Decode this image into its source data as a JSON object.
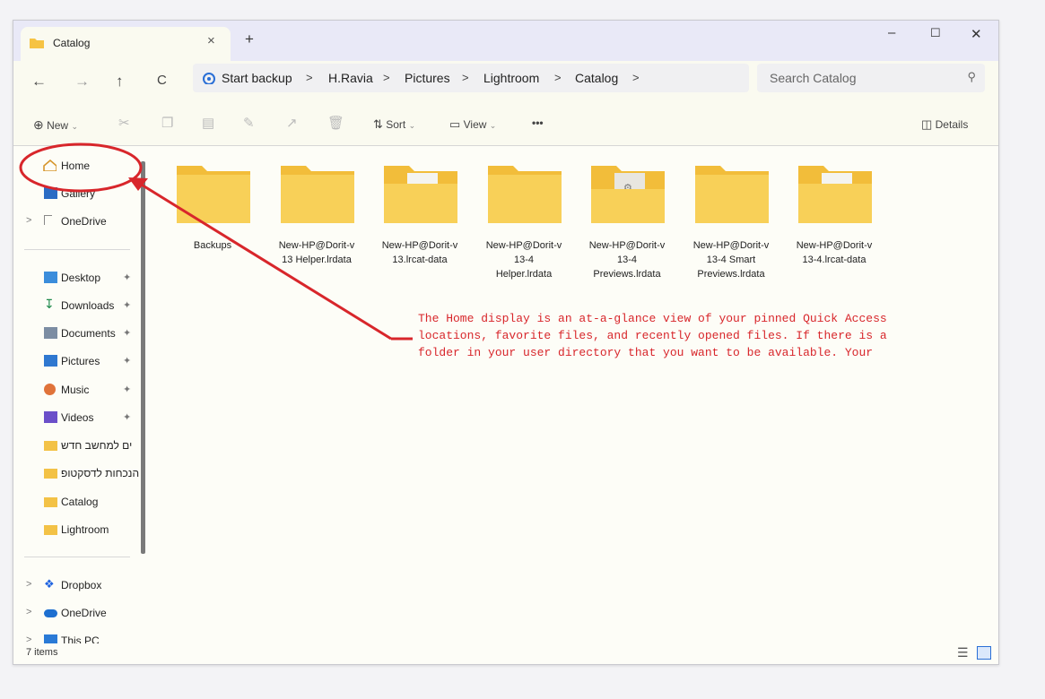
{
  "window": {
    "tab_title": "Catalog",
    "tab_close": "×",
    "new_tab": "+",
    "minimize": "–",
    "maximize": "☐",
    "close": "✕"
  },
  "nav": {
    "back": "←",
    "forward": "→",
    "up": "↑",
    "refresh": "C"
  },
  "breadcrumb": {
    "start": "Start backup",
    "parts": [
      "H.Ravia",
      "Pictures",
      "Lightroom",
      "Catalog"
    ],
    "sep": ">"
  },
  "search": {
    "placeholder": "Search Catalog",
    "icon": "search-icon"
  },
  "toolbar": {
    "new_label": "New",
    "sort_label": "Sort",
    "view_label": "View",
    "more_label": "•••",
    "details_label": "Details"
  },
  "sidebar": {
    "items": [
      {
        "label": "Home",
        "icon": "home-icon"
      },
      {
        "label": "Gallery",
        "icon": "gallery-icon"
      },
      {
        "label": "OneDrive",
        "icon": "onedrive-icon"
      },
      {
        "label": "Desktop",
        "icon": "desktop-icon"
      },
      {
        "label": "Downloads",
        "icon": "downloads-icon"
      },
      {
        "label": "Documents",
        "icon": "documents-icon"
      },
      {
        "label": "Pictures",
        "icon": "pictures-icon"
      },
      {
        "label": "Music",
        "icon": "music-icon"
      },
      {
        "label": "Videos",
        "icon": "videos-icon"
      },
      {
        "label": "ים למחשב חדש",
        "icon": "folder-icon"
      },
      {
        "label": "הנכחות לדסקטופ",
        "icon": "folder-icon"
      },
      {
        "label": "Catalog",
        "icon": "folder-icon"
      },
      {
        "label": "Lightroom",
        "icon": "folder-icon"
      },
      {
        "label": "Dropbox",
        "icon": "dropbox-icon"
      },
      {
        "label": "OneDrive",
        "icon": "onedrive-cloud-icon"
      },
      {
        "label": "This PC",
        "icon": "this-pc-icon"
      }
    ]
  },
  "folders": [
    {
      "lines": [
        "Backups"
      ]
    },
    {
      "lines": [
        "New-HP@Dorit-v",
        "13 Helper.lrdata"
      ]
    },
    {
      "lines": [
        "New-HP@Dorit-v",
        "13.lrcat-data"
      ]
    },
    {
      "lines": [
        "New-HP@Dorit-v",
        "13-4",
        "Helper.lrdata"
      ]
    },
    {
      "lines": [
        "New-HP@Dorit-v",
        "13-4",
        "Previews.lrdata"
      ]
    },
    {
      "lines": [
        "New-HP@Dorit-v",
        "13-4 Smart",
        "Previews.lrdata"
      ]
    },
    {
      "lines": [
        "New-HP@Dorit-v",
        "13-4.lrcat-data"
      ]
    }
  ],
  "status": {
    "count": "7 items"
  },
  "annotation": {
    "lines": [
      "The Home display is an at-a-glance view of your pinned Quick Access",
      "locations, favorite files, and recently opened files. If there is a",
      "folder in your user directory that you want to be available. Your"
    ],
    "color": "#d8262b"
  }
}
